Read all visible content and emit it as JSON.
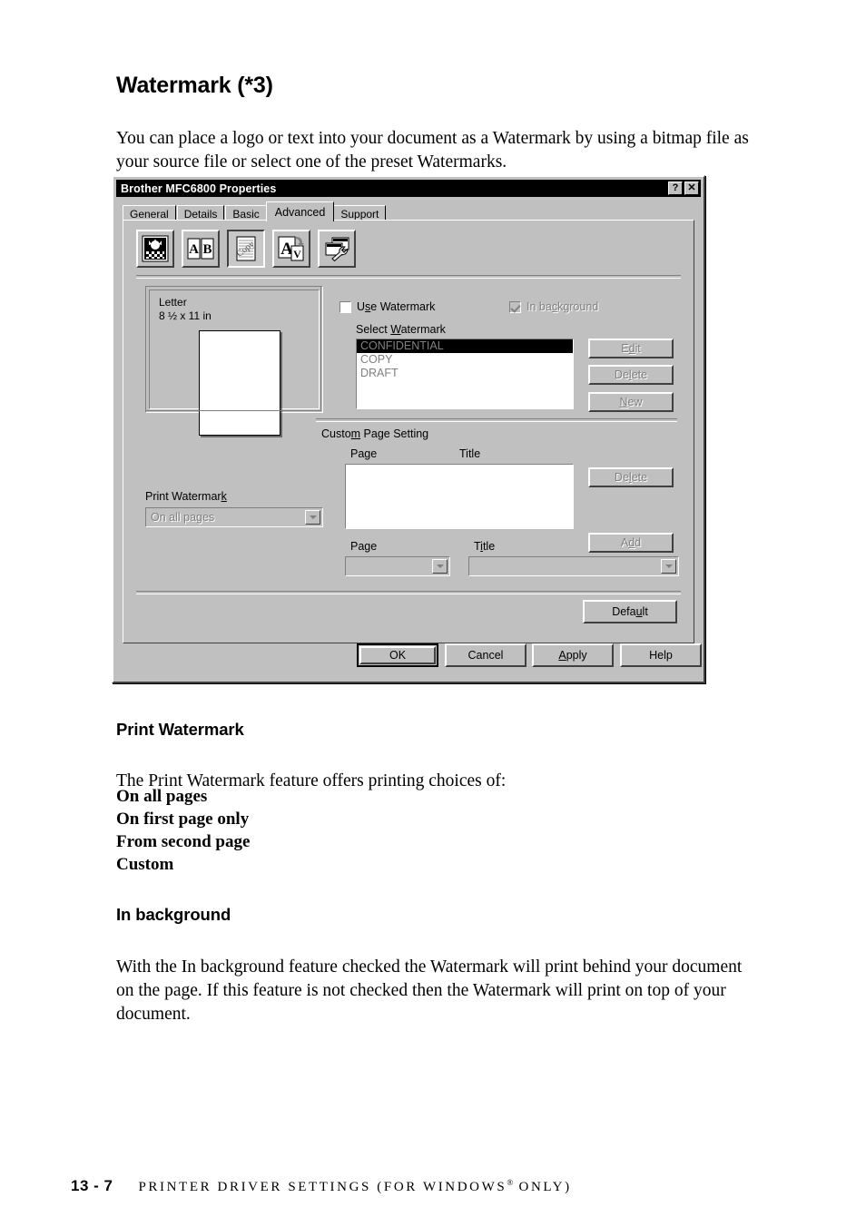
{
  "document": {
    "title": "Watermark (*3)",
    "intro": "You can place a logo or text into your document as a Watermark by using a bitmap file as your source file or select one of the preset Watermarks.",
    "sections": [
      {
        "heading": "Print Watermark",
        "body": "The Print Watermark feature offers printing choices of:",
        "choices": [
          "On all pages",
          "On first page only",
          "From second page",
          "Custom"
        ]
      },
      {
        "heading": "In background",
        "body": "With the In background feature checked the Watermark will print behind your document on the page. If this feature is not checked then the Watermark will print on top of your document."
      }
    ],
    "footer": {
      "page_number": "13 - 7",
      "breadcrumb_pre": "Printer Driver Settings (For Windows",
      "breadcrumb_sup": "®",
      "breadcrumb_post": " Only)"
    }
  },
  "dialog": {
    "title": "Brother MFC6800 Properties",
    "titlebar_buttons": [
      {
        "name": "help-button",
        "glyph": "?"
      },
      {
        "name": "close-button",
        "glyph": "✕"
      }
    ],
    "tabs": [
      {
        "label": "General",
        "active": false
      },
      {
        "label": "Details",
        "active": false
      },
      {
        "label": "Basic",
        "active": false
      },
      {
        "label": "Advanced",
        "active": true
      },
      {
        "label": "Support",
        "active": false
      }
    ],
    "toolbar": [
      {
        "name": "halftone-image-icon",
        "pressed": false
      },
      {
        "name": "two-in-one-icon",
        "pressed": false
      },
      {
        "name": "watermark-page-icon",
        "pressed": true
      },
      {
        "name": "page-orientation-icon",
        "pressed": false
      },
      {
        "name": "device-options-icon",
        "pressed": false
      }
    ],
    "preview": {
      "paper_name": "Letter",
      "paper_size": "8 ½ x 11 in"
    },
    "print_watermark": {
      "label": "Print Watermark",
      "value": "On all pages",
      "enabled": false
    },
    "use_watermark": {
      "label_pre": "U",
      "label_key": "s",
      "label_post": "e Watermark",
      "checked": false,
      "enabled": true
    },
    "in_background": {
      "label_pre": "In ba",
      "label_key": "c",
      "label_post": "kground",
      "checked": true,
      "enabled": false
    },
    "select_watermark": {
      "label_pre": "Select ",
      "label_key": "W",
      "label_post": "atermark",
      "items": [
        "CONFIDENTIAL",
        "COPY",
        "DRAFT"
      ],
      "selected_index": 0,
      "buttons": [
        {
          "label_pre": "E",
          "label_key": "d",
          "label_post": "it",
          "name": "edit-watermark-button",
          "enabled": false
        },
        {
          "label_pre": "De",
          "label_key": "l",
          "label_post": "ete",
          "name": "delete-watermark-button",
          "enabled": false
        },
        {
          "label_pre": "",
          "label_key": "N",
          "label_post": "ew",
          "name": "new-watermark-button",
          "enabled": false
        }
      ]
    },
    "custom_page_setting": {
      "label_pre": "Custo",
      "label_key": "m",
      "label_post": " Page Setting",
      "columns": [
        "Page",
        "Title"
      ],
      "rows": [],
      "delete_button": {
        "label_pre": "De",
        "label_key": "l",
        "label_post": "ete",
        "enabled": false
      },
      "add_button": {
        "label_pre": "A",
        "label_key": "d",
        "label_post": "d",
        "enabled": false
      },
      "page_field": {
        "label_pre": "Pa",
        "label_key": "g",
        "label_post": "e",
        "value": "",
        "enabled": false
      },
      "title_field": {
        "label_pre": "T",
        "label_key": "i",
        "label_post": "tle",
        "value": "",
        "enabled": false
      }
    },
    "default_button": {
      "label_pre": "Defa",
      "label_key": "u",
      "label_post": "lt",
      "enabled": true
    },
    "footer_buttons": [
      {
        "label_pre": "",
        "label_key": "",
        "label_post": "OK",
        "name": "ok-button",
        "default": true
      },
      {
        "label_pre": "",
        "label_key": "",
        "label_post": "Cancel",
        "name": "cancel-button",
        "default": false
      },
      {
        "label_pre": "",
        "label_key": "A",
        "label_post": "pply",
        "name": "apply-button",
        "default": false
      },
      {
        "label_pre": "",
        "label_key": "",
        "label_post": "Help",
        "name": "help-button-footer",
        "default": false
      }
    ]
  }
}
